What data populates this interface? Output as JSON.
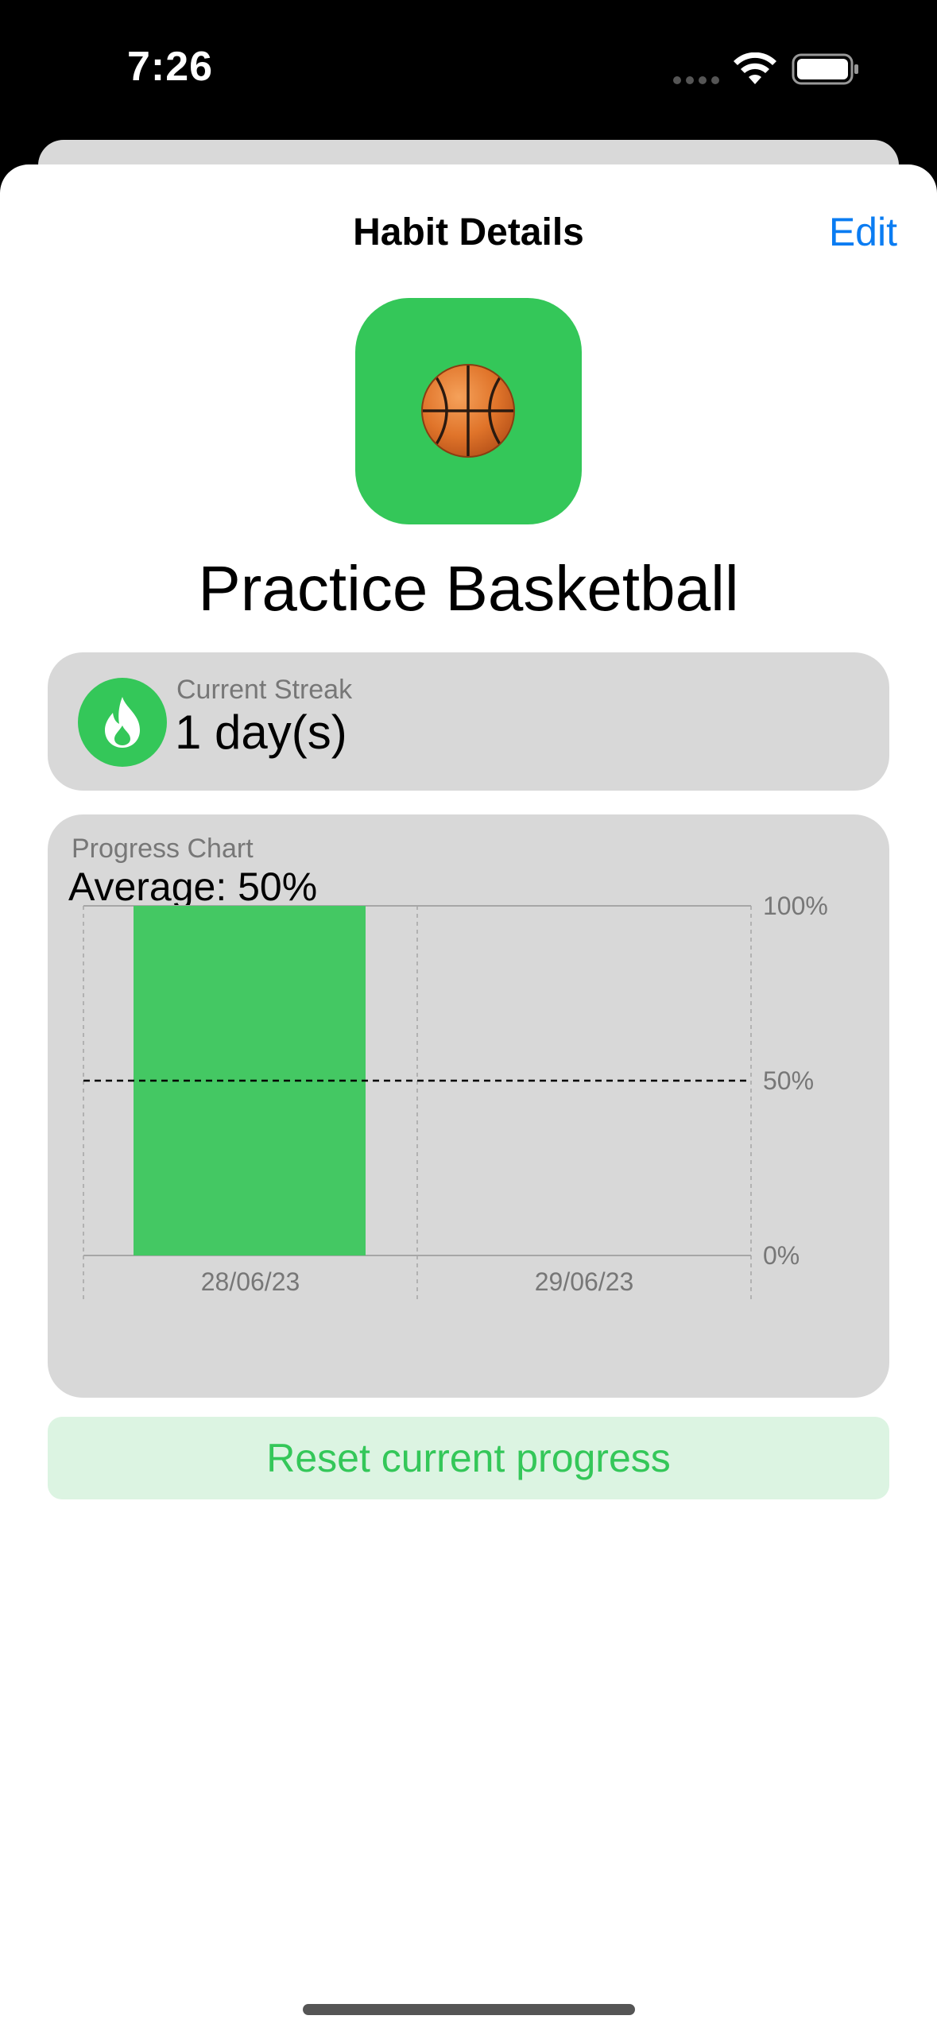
{
  "status_bar": {
    "time": "7:26",
    "icons": [
      "signal-dots-icon",
      "wifi-icon",
      "battery-icon"
    ]
  },
  "nav": {
    "title": "Habit Details",
    "edit_label": "Edit"
  },
  "habit": {
    "icon": "basketball-icon",
    "name": "Practice Basketball",
    "accent_color": "#34c759"
  },
  "streak": {
    "icon": "flame-icon",
    "label": "Current Streak",
    "value": "1 day(s)"
  },
  "progress": {
    "label": "Progress Chart",
    "average": "Average: 50%"
  },
  "chart_data": {
    "type": "bar",
    "categories": [
      "28/06/23",
      "29/06/23"
    ],
    "values": [
      100,
      0
    ],
    "y_ticks": [
      "100%",
      "50%",
      "0%"
    ],
    "ylim": [
      0,
      100
    ],
    "average_line": 50,
    "bar_color": "#44c863",
    "grid": true
  },
  "actions": {
    "reset_label": "Reset current progress"
  }
}
